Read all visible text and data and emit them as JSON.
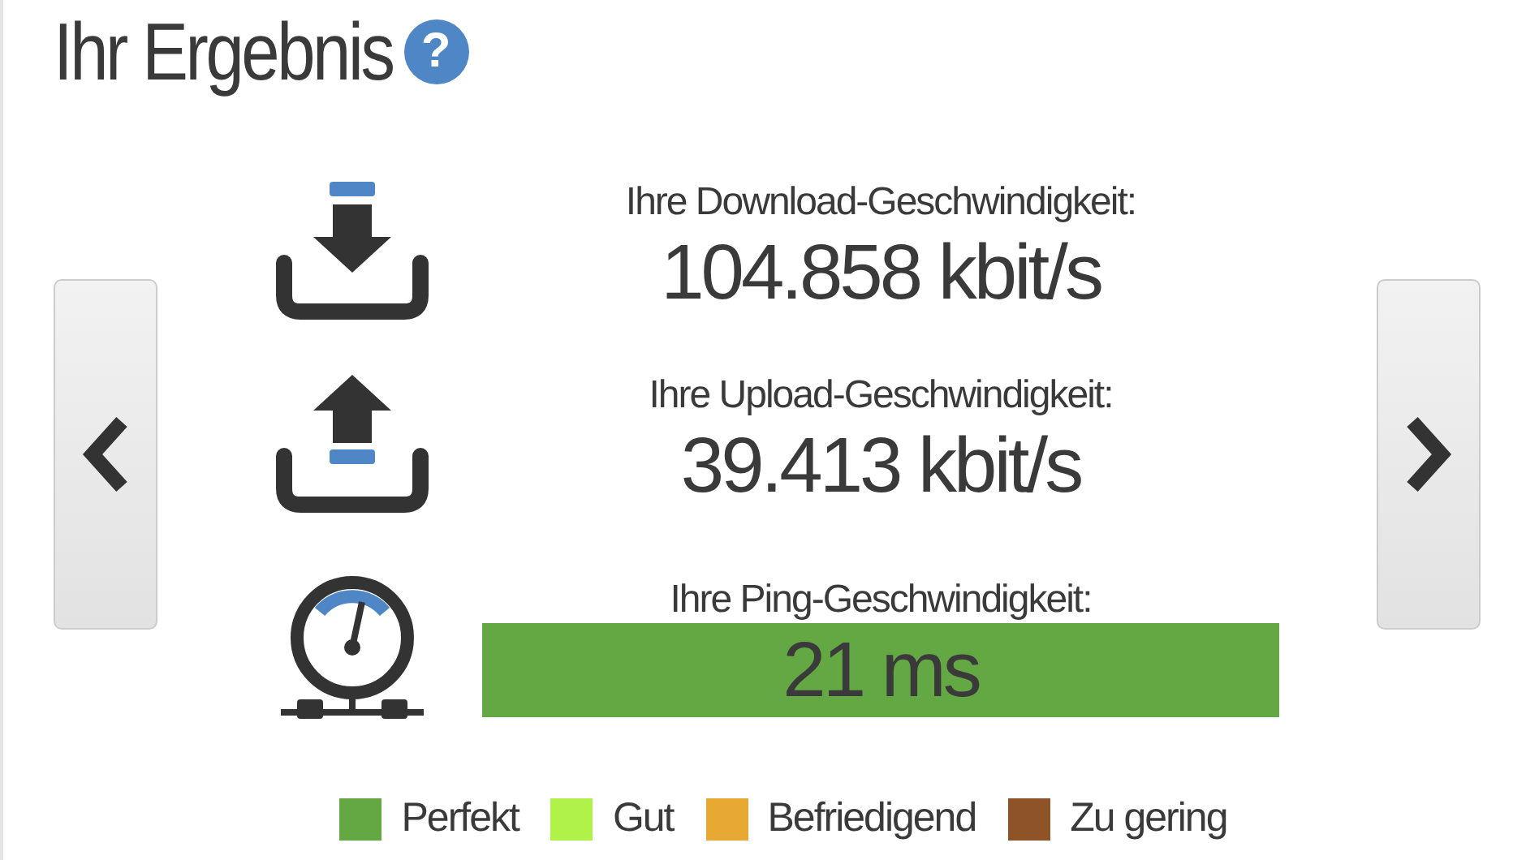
{
  "title": "Ihr Ergebnis",
  "help_icon": "?",
  "results": [
    {
      "kind": "download",
      "label": "Ihre Download-Geschwindigkeit:",
      "value": "104.858 kbit/s"
    },
    {
      "kind": "upload",
      "label": "Ihre Upload-Geschwindigkeit:",
      "value": "39.413 kbit/s"
    },
    {
      "kind": "ping",
      "label": "Ihre Ping-Geschwindigkeit:",
      "value": "21 ms",
      "color": "#64a844"
    }
  ],
  "legend": [
    {
      "label": "Perfekt",
      "color": "#64a844"
    },
    {
      "label": "Gut",
      "color": "#b0f24a"
    },
    {
      "label": "Befriedigend",
      "color": "#e8a834"
    },
    {
      "label": "Zu gering",
      "color": "#8e5428"
    }
  ]
}
